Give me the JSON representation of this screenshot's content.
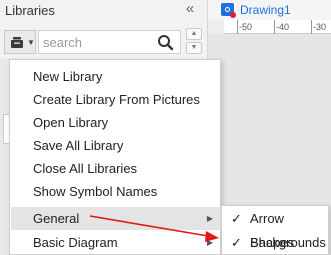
{
  "panel": {
    "title": "Libraries",
    "collapse_icon": "double-chevron-left-icon",
    "library_menu_icon": "library-stack-icon",
    "search": {
      "placeholder": "search",
      "value": ""
    }
  },
  "document": {
    "tab_label": "Drawing1",
    "ruler_ticks": [
      "-50",
      "-40",
      "-30"
    ]
  },
  "context_menu": {
    "items": [
      {
        "label": "New Library"
      },
      {
        "label": "Create Library From Pictures"
      },
      {
        "label": "Open Library"
      },
      {
        "label": "Save All Library"
      },
      {
        "label": "Close All Libraries"
      },
      {
        "label": "Show Symbol Names"
      },
      {
        "label": "General",
        "has_submenu": true,
        "highlighted": true
      },
      {
        "label": "Basic Diagram",
        "has_submenu": true
      }
    ]
  },
  "submenu": {
    "items": [
      {
        "label": "Arrow Shapes",
        "checked": true
      },
      {
        "label": "Backgrounds",
        "checked": true
      }
    ]
  },
  "colors": {
    "accent": "#1f6fe0",
    "annotation_arrow": "#e01818",
    "highlight": "#e4e4e4"
  }
}
